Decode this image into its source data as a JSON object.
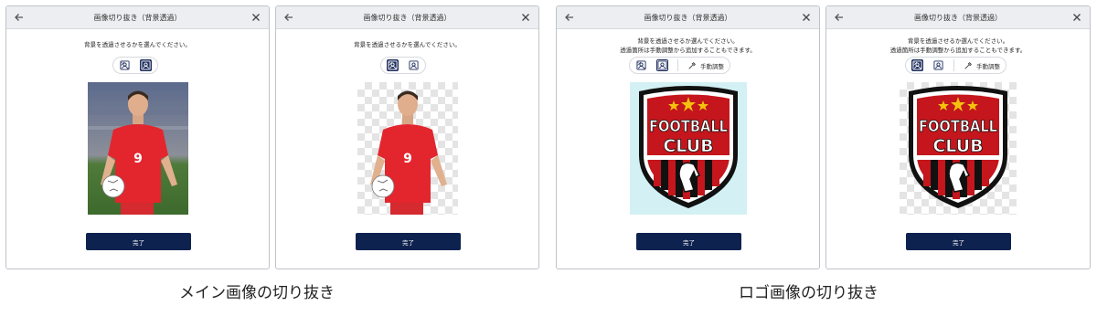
{
  "dialogs": [
    {
      "title": "画像切り抜き（背景透過）",
      "instruction_lines": [
        "背景を透過させるかを選んでください。"
      ],
      "done_label": "完了",
      "selected_mode": "original"
    },
    {
      "title": "画像切り抜き（背景透過）",
      "instruction_lines": [
        "背景を透過させるかを選んでください。"
      ],
      "done_label": "完了",
      "selected_mode": "transparent"
    },
    {
      "title": "画像切り抜き（背景透過）",
      "instruction_lines": [
        "背景を透過させるか選んでください。",
        "透過箇所は手動調整から追加することもできます。"
      ],
      "manual_label": "手動調整",
      "done_label": "完了",
      "selected_mode": "transparent"
    },
    {
      "title": "画像切り抜き（背景透過）",
      "instruction_lines": [
        "背景を透過させるか選んでください。",
        "透過箇所は手動調整から追加することもできます。"
      ],
      "manual_label": "手動調整",
      "done_label": "完了",
      "selected_mode": "original"
    }
  ],
  "logo": {
    "line1": "FOOTBALL",
    "line2": "CLUB"
  },
  "player": {
    "number": "9"
  },
  "captions": {
    "main": "メイン画像の切り抜き",
    "logo": "ロゴ画像の切り抜き"
  },
  "colors": {
    "accent": "#0e2250",
    "jersey": "#e3262e",
    "logo_red": "#c4161c",
    "logo_bg": "#d3f1f5"
  }
}
